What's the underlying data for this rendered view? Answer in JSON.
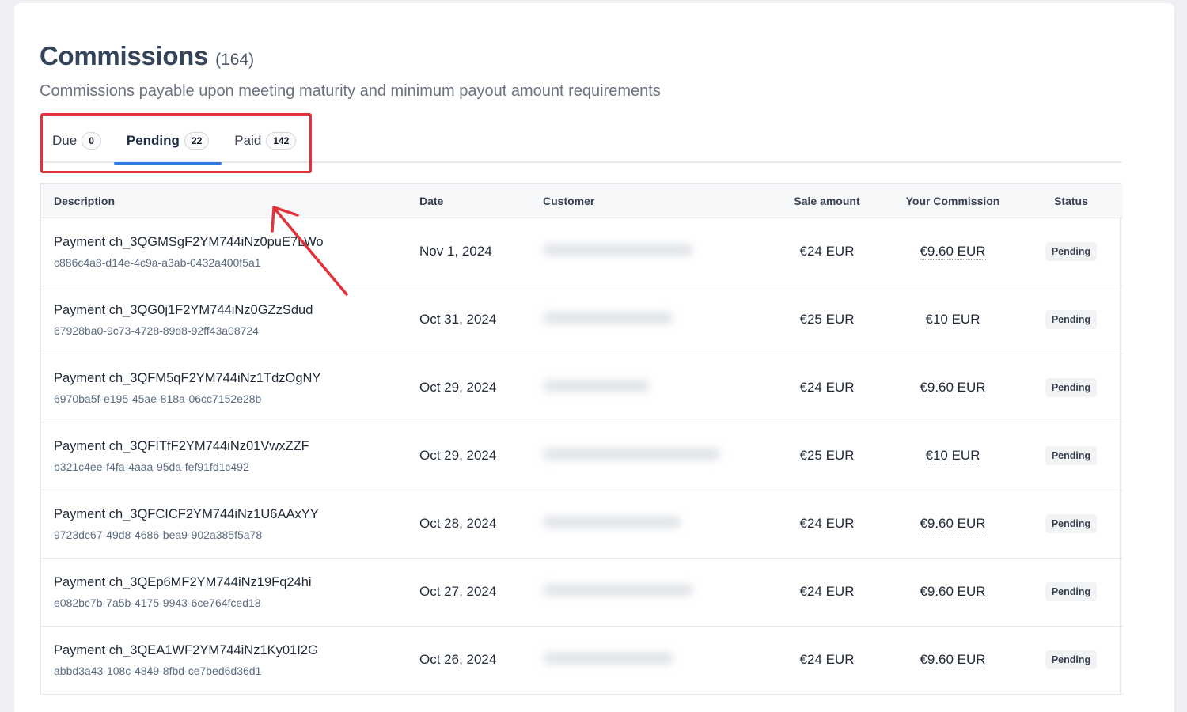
{
  "header": {
    "title": "Commissions",
    "count": "(164)",
    "subtitle": "Commissions payable upon meeting maturity and minimum payout amount requirements"
  },
  "tabs": [
    {
      "label": "Due",
      "count": "0",
      "active": false
    },
    {
      "label": "Pending",
      "count": "22",
      "active": true
    },
    {
      "label": "Paid",
      "count": "142",
      "active": false
    }
  ],
  "table": {
    "columns": [
      "Description",
      "Date",
      "Customer",
      "Sale amount",
      "Your Commission",
      "Status"
    ],
    "rows": [
      {
        "description": "Payment ch_3QGMSgF2YM744iNz0puE7LWo",
        "id": "c886c4a8-d14e-4c9a-a3ab-0432a400f5a1",
        "date": "Nov 1, 2024",
        "sale": "€24 EUR",
        "commission": "€9.60 EUR",
        "status": "Pending"
      },
      {
        "description": "Payment ch_3QG0j1F2YM744iNz0GZzSdud",
        "id": "67928ba0-9c73-4728-89d8-92ff43a08724",
        "date": "Oct 31, 2024",
        "sale": "€25 EUR",
        "commission": "€10 EUR",
        "status": "Pending"
      },
      {
        "description": "Payment ch_3QFM5qF2YM744iNz1TdzOgNY",
        "id": "6970ba5f-e195-45ae-818a-06cc7152e28b",
        "date": "Oct 29, 2024",
        "sale": "€24 EUR",
        "commission": "€9.60 EUR",
        "status": "Pending"
      },
      {
        "description": "Payment ch_3QFITfF2YM744iNz01VwxZZF",
        "id": "b321c4ee-f4fa-4aaa-95da-fef91fd1c492",
        "date": "Oct 29, 2024",
        "sale": "€25 EUR",
        "commission": "€10 EUR",
        "status": "Pending"
      },
      {
        "description": "Payment ch_3QFCICF2YM744iNz1U6AAxYY",
        "id": "9723dc67-49d8-4686-bea9-902a385f5a78",
        "date": "Oct 28, 2024",
        "sale": "€24 EUR",
        "commission": "€9.60 EUR",
        "status": "Pending"
      },
      {
        "description": "Payment ch_3QEp6MF2YM744iNz19Fq24hi",
        "id": "e082bc7b-7a5b-4175-9943-6ce764fced18",
        "date": "Oct 27, 2024",
        "sale": "€24 EUR",
        "commission": "€9.60 EUR",
        "status": "Pending"
      },
      {
        "description": "Payment ch_3QEA1WF2YM744iNz1Ky01I2G",
        "id": "abbd3a43-108c-4849-8fbd-ce7bed6d36d1",
        "date": "Oct 26, 2024",
        "sale": "€24 EUR",
        "commission": "€9.60 EUR",
        "status": "Pending"
      }
    ]
  },
  "colors": {
    "accent": "#2f7de1",
    "annotation": "#e0333b",
    "title": "#33435a"
  }
}
